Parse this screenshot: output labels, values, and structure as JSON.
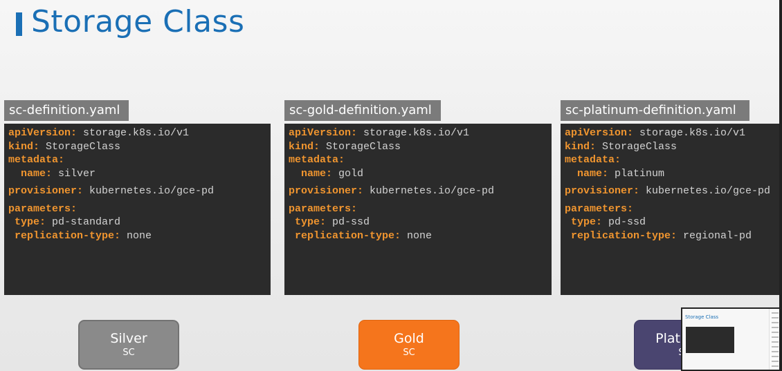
{
  "slide": {
    "title": "Storage Class"
  },
  "files": [
    {
      "filename": "sc-definition.yaml",
      "lines": [
        {
          "key": "apiVersion:",
          "value": " storage.k8s.io/v1"
        },
        {
          "key": "kind:",
          "value": " StorageClass"
        },
        {
          "key": "metadata:",
          "value": ""
        },
        {
          "key": "  name:",
          "value": " silver"
        },
        {
          "key": "provisioner:",
          "value": " kubernetes.io/gce-pd"
        },
        {
          "key": "parameters:",
          "value": ""
        },
        {
          "key": " type:",
          "value": " pd-standard"
        },
        {
          "key": " replication-type:",
          "value": " none"
        }
      ]
    },
    {
      "filename": "sc-gold-definition.yaml",
      "lines": [
        {
          "key": "apiVersion:",
          "value": " storage.k8s.io/v1"
        },
        {
          "key": "kind:",
          "value": " StorageClass"
        },
        {
          "key": "metadata:",
          "value": ""
        },
        {
          "key": "  name:",
          "value": " gold"
        },
        {
          "key": "provisioner:",
          "value": " kubernetes.io/gce-pd"
        },
        {
          "key": "parameters:",
          "value": ""
        },
        {
          "key": " type:",
          "value": " pd-ssd"
        },
        {
          "key": " replication-type:",
          "value": " none"
        }
      ]
    },
    {
      "filename": "sc-platinum-definition.yaml",
      "lines": [
        {
          "key": "apiVersion:",
          "value": " storage.k8s.io/v1"
        },
        {
          "key": "kind:",
          "value": " StorageClass"
        },
        {
          "key": "metadata:",
          "value": ""
        },
        {
          "key": "  name:",
          "value": " platinum"
        },
        {
          "key": "provisioner:",
          "value": " kubernetes.io/gce-pd"
        },
        {
          "key": "parameters:",
          "value": ""
        },
        {
          "key": " type:",
          "value": " pd-ssd"
        },
        {
          "key": " replication-type:",
          "value": " regional-pd"
        }
      ]
    }
  ],
  "classes": [
    {
      "label": "Silver",
      "sub": "SC",
      "color": "#8a8a8a"
    },
    {
      "label": "Gold",
      "sub": "SC",
      "color": "#f5751c"
    },
    {
      "label": "Platinum",
      "sub": "SC",
      "color": "#4a4570"
    }
  ],
  "thumbnail": {
    "title": "Storage Class"
  },
  "colors": {
    "accent": "#1a6fb5",
    "yaml_key": "#f0952f",
    "code_bg": "#2b2b2b"
  }
}
